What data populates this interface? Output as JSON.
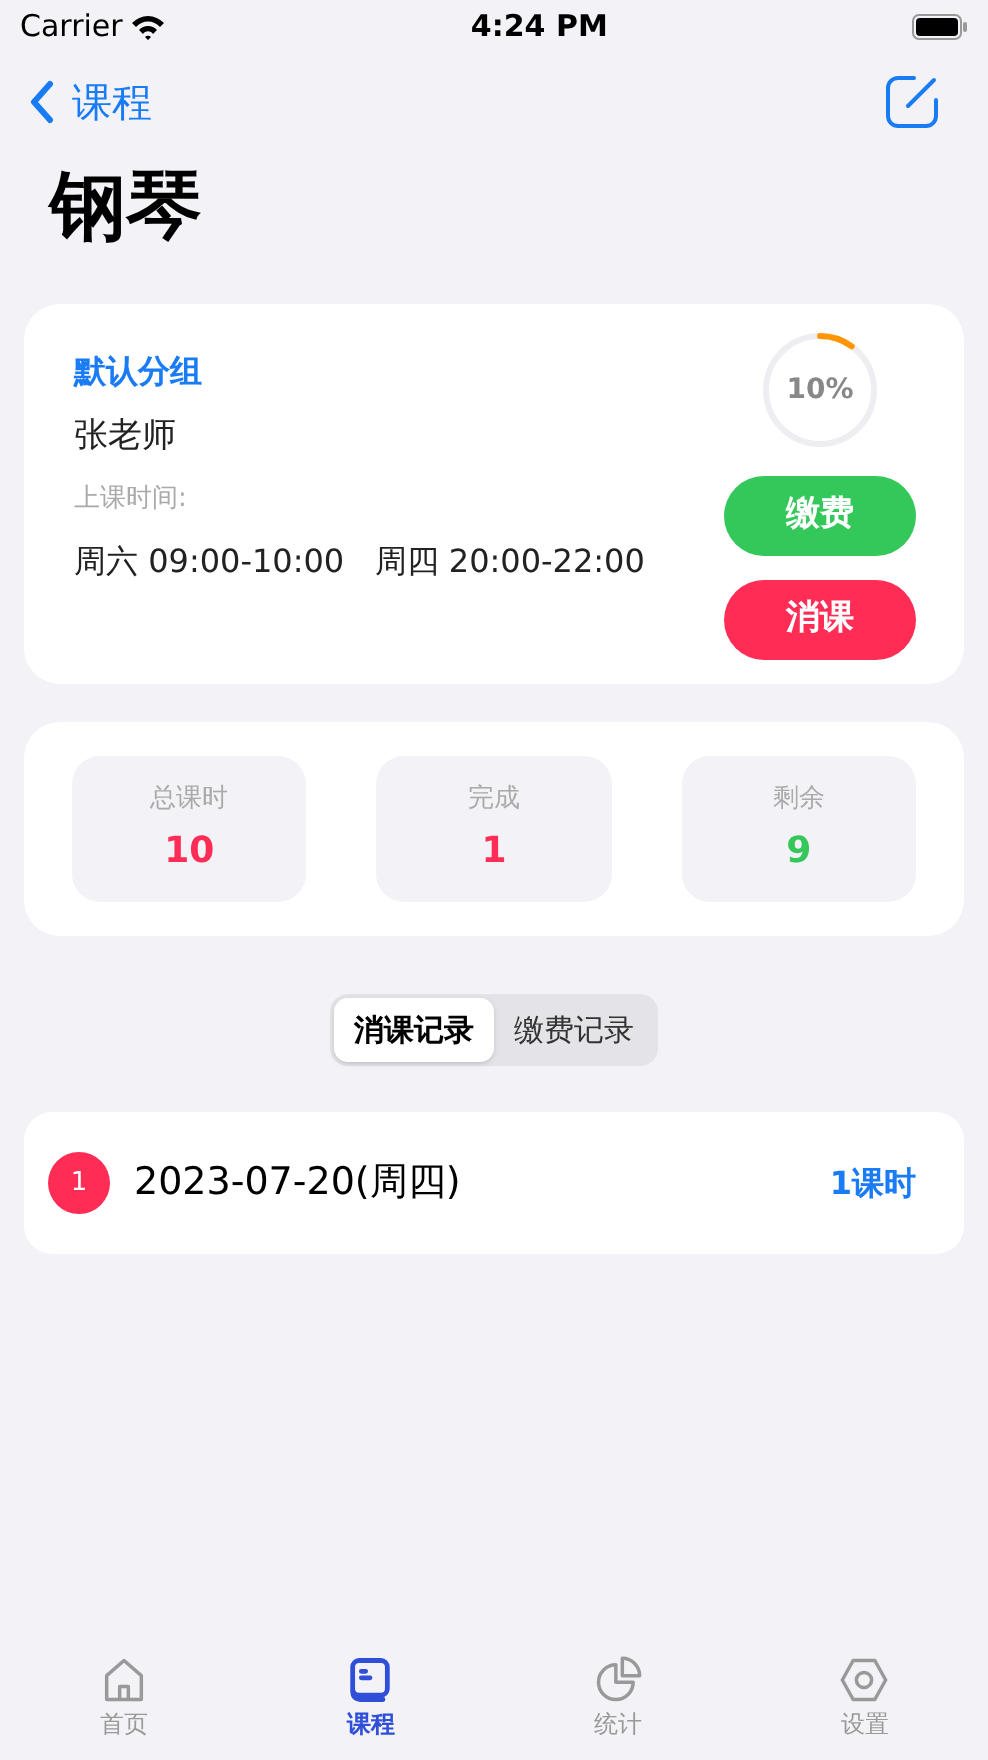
{
  "status_bar": {
    "carrier": "Carrier",
    "time": "4:24 PM"
  },
  "nav": {
    "back_label": "课程"
  },
  "title": "钢琴",
  "course": {
    "group": "默认分组",
    "teacher": "张老师",
    "schedule_label": "上课时间:",
    "schedule": "周六 09:00-10:00   周四 20:00-22:00",
    "progress": {
      "reading": "10%"
    },
    "buttons": [
      {
        "label": "缴费",
        "color": "#34c759"
      },
      {
        "label": "消课",
        "color": "#ff2d55"
      }
    ]
  },
  "stats": [
    {
      "label": "总课时",
      "value": "10",
      "color": "#ff2d55"
    },
    {
      "label": "完成",
      "value": "1",
      "color": "#ff2d55"
    },
    {
      "label": "剩余",
      "value": "9",
      "color": "#34c759"
    }
  ],
  "segments": [
    {
      "label": "消课记录",
      "selected": true
    },
    {
      "label": "缴费记录",
      "selected": false
    }
  ],
  "records": [
    {
      "index": "1",
      "date": "2023-07-20(周四)",
      "amount": "1课时"
    }
  ],
  "tab_bar": [
    {
      "kind": "home",
      "label": "首页",
      "selected": false
    },
    {
      "kind": "book",
      "label": "课程",
      "selected": true
    },
    {
      "kind": "chart",
      "label": "统计",
      "selected": false
    },
    {
      "kind": "gear",
      "label": "设置",
      "selected": false
    }
  ]
}
